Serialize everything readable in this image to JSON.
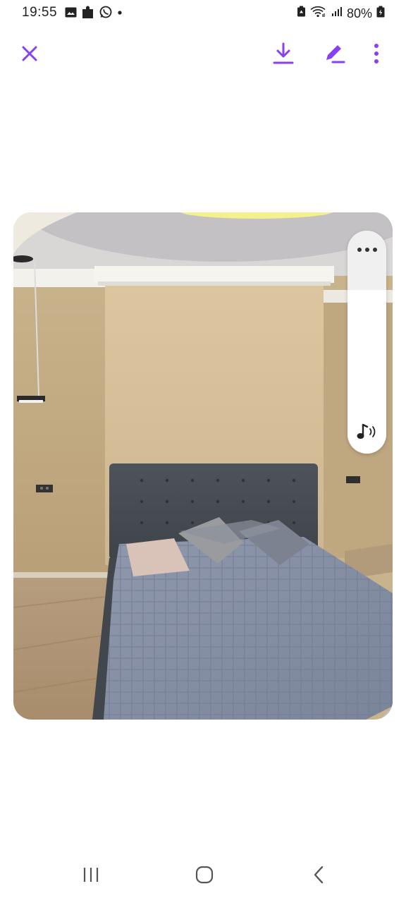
{
  "status_bar": {
    "time": "19:55",
    "battery": "80%",
    "notification_icons": [
      "image-icon",
      "puzzle-icon",
      "whatsapp-icon",
      "dot-icon"
    ],
    "system_icons": [
      "battery-saver-icon",
      "wifi-icon",
      "signal-icon",
      "battery-icon"
    ]
  },
  "toolbar": {
    "icons": [
      "close-icon",
      "download-icon",
      "edit-icon",
      "more-vert-icon"
    ],
    "accent_color": "#8a3ff2"
  },
  "photo": {
    "subject_icon": "bedroom-photo"
  },
  "volume_panel": {
    "icons": [
      "more-horiz-icon",
      "music-note-icon"
    ],
    "level": 0.73
  },
  "nav_bar": {
    "icons": [
      "recents-icon",
      "home-icon",
      "back-icon"
    ]
  }
}
